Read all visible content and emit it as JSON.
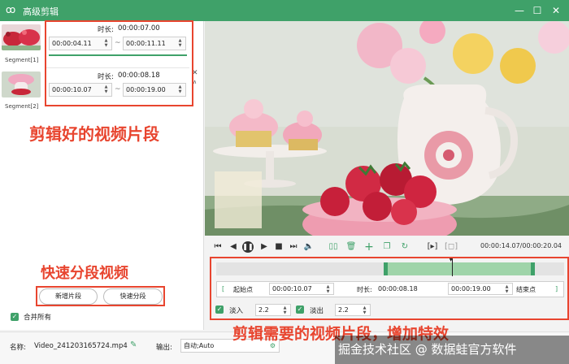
{
  "window": {
    "title": "高级剪辑",
    "icon": "app-logo-icon"
  },
  "segments": [
    {
      "label": "Segment[1]",
      "duration_label": "时长:",
      "duration": "00:00:07.00",
      "start": "00:00:04.11",
      "end": "00:00:11.11"
    },
    {
      "label": "Segment[2]",
      "duration_label": "时长:",
      "duration": "00:00:08.18",
      "start": "00:00:10.07",
      "end": "00:00:19.00"
    }
  ],
  "annotations": {
    "clipped_segments": "剪辑好的视频片段",
    "quick_split": "快速分段视频",
    "needed_segments": "剪辑需要的视频片段，增加特效"
  },
  "left_buttons": {
    "add_segment": "新增片段",
    "quick_split": "快速分段"
  },
  "merge_all": "合并所有",
  "player": {
    "time": "00:00:14.07/00:00:20.04"
  },
  "trim": {
    "start_label": "起始点",
    "start_value": "00:00:10.07",
    "duration_label": "时长:",
    "duration_value": "00:00:08.18",
    "end_value": "00:00:19.00",
    "end_label": "结束点"
  },
  "effects": {
    "fade_in_label": "淡入",
    "fade_in_value": "2.2",
    "fade_out_label": "淡出",
    "fade_out_value": "2.2"
  },
  "output": {
    "name_label": "名称:",
    "name_value": "Video_241203165724.mp4",
    "output_label": "输出:",
    "output_value": "自动;Auto"
  },
  "watermark": "掘金技术社区 @ 数据蛙官方软件",
  "colors": {
    "accent": "#3fa169",
    "annotation": "#e8452f"
  }
}
